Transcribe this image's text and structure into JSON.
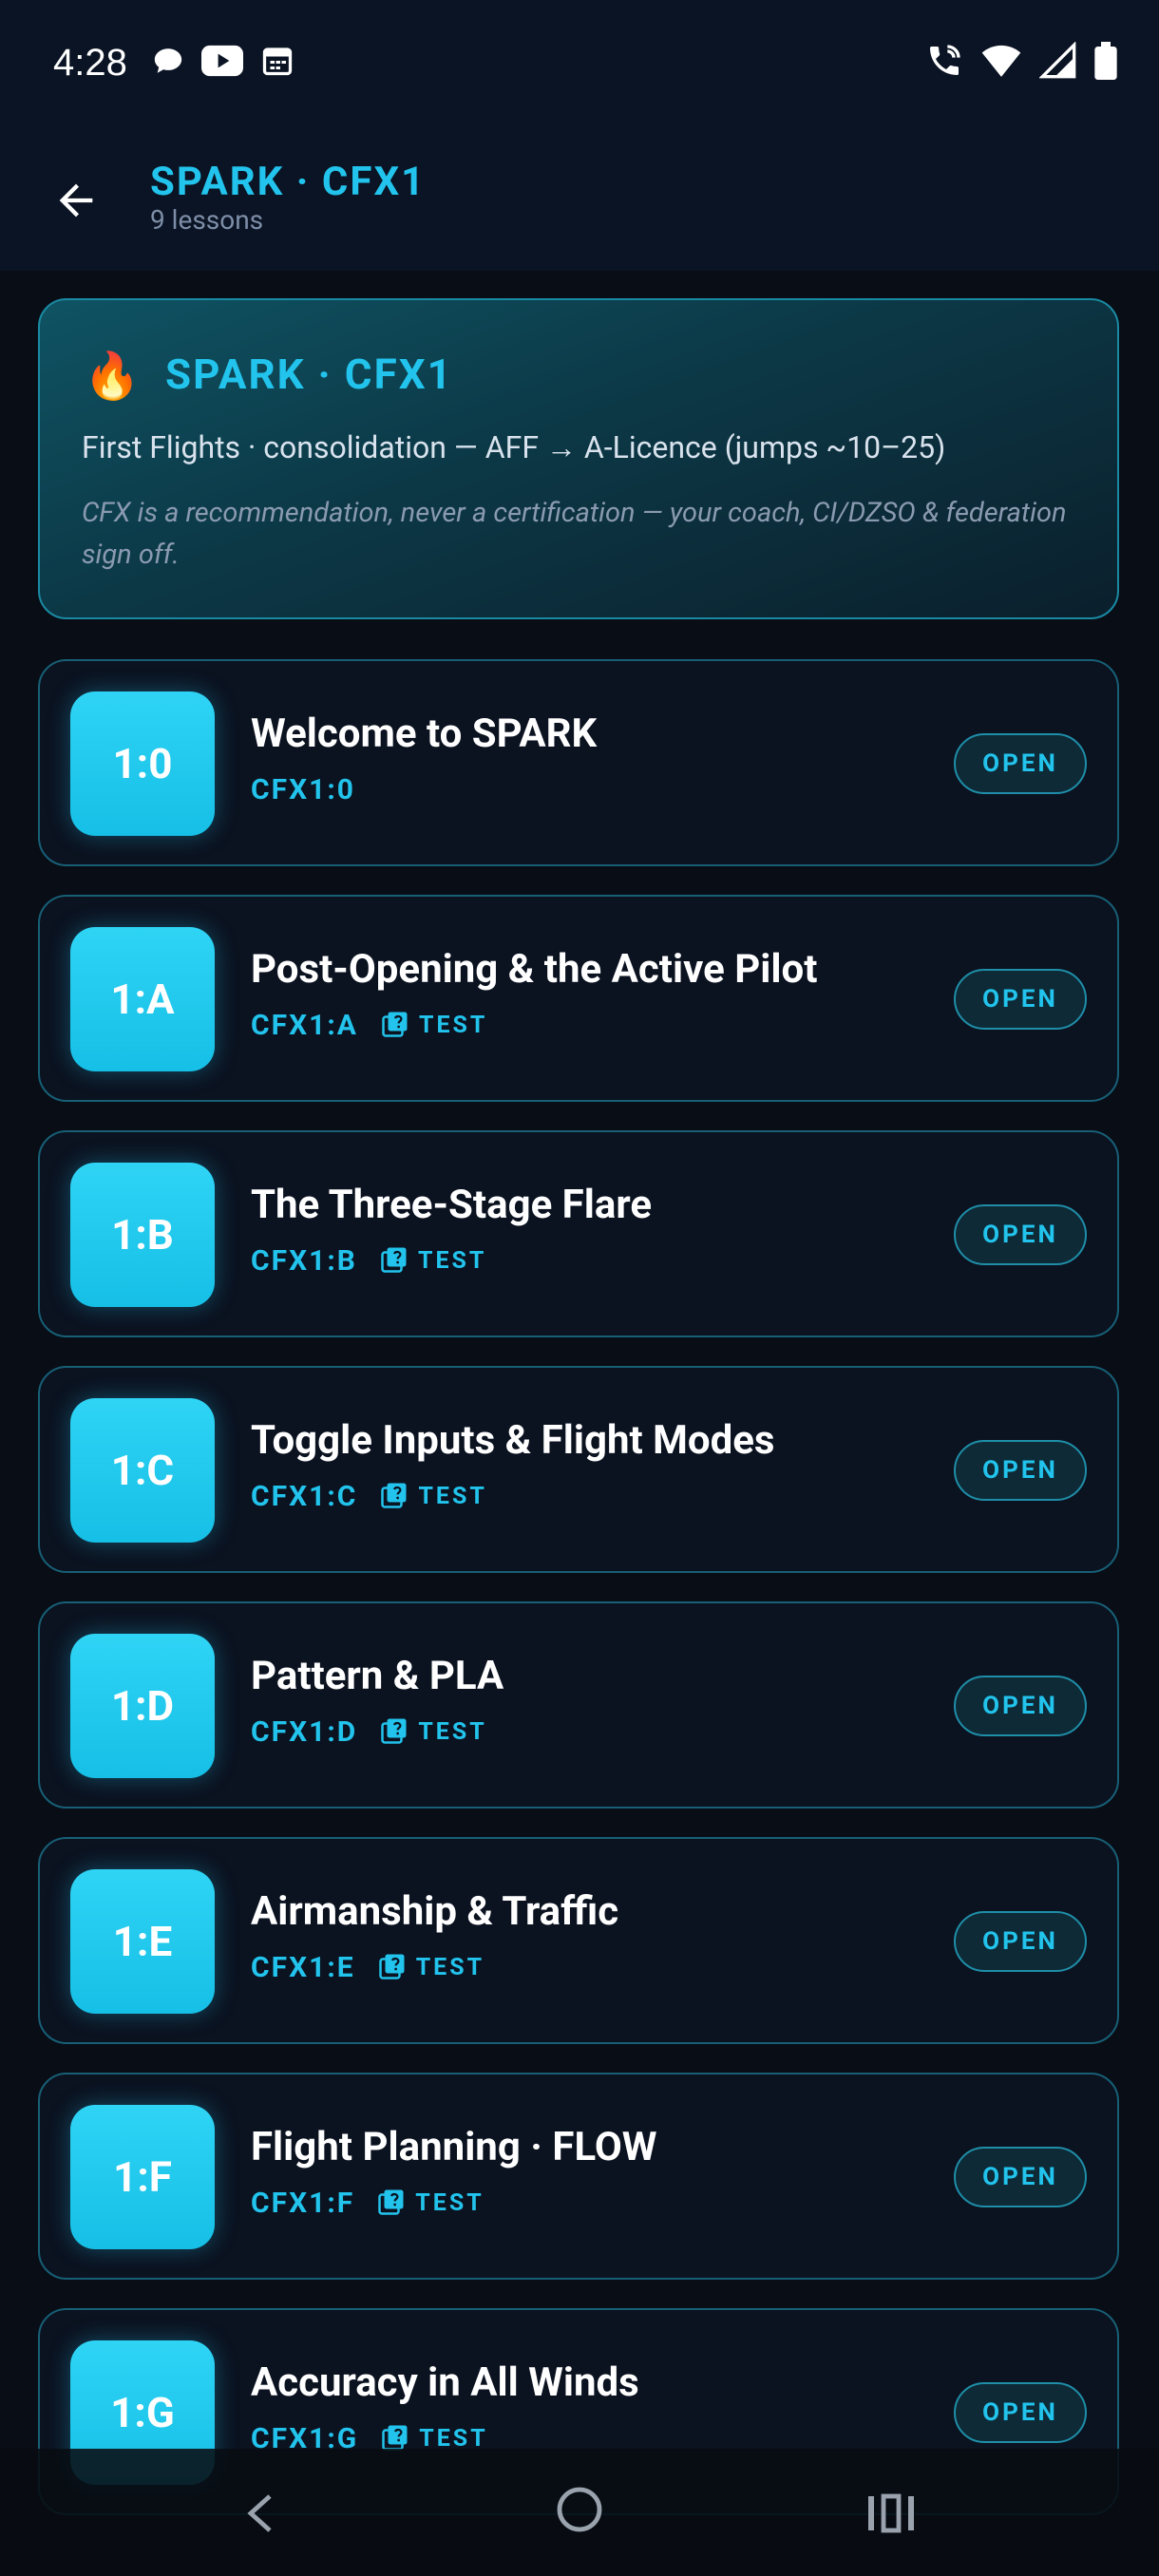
{
  "status_bar": {
    "time": "4:28",
    "left_icons": [
      "chat-bubble-icon",
      "youtube-icon",
      "calendar-icon"
    ],
    "right_icons": [
      "wifi-calling-icon",
      "wifi-icon",
      "signal-icon",
      "battery-icon"
    ]
  },
  "app_bar": {
    "title": "SPARK · CFX1",
    "subtitle": "9 lessons"
  },
  "hero": {
    "icon": "🔥",
    "title": "SPARK · CFX1",
    "description": "First Flights · consolidation — AFF → A-Licence (jumps ~10–25)",
    "note": "CFX is a recommendation, never a certification — your coach, CI/DZSO & federation sign off."
  },
  "open_label": "OPEN",
  "test_label": "TEST",
  "lessons": [
    {
      "badge": "1:0",
      "title": "Welcome to SPARK",
      "code": "CFX1:0",
      "has_test": false
    },
    {
      "badge": "1:A",
      "title": "Post-Opening & the Active Pilot",
      "code": "CFX1:A",
      "has_test": true
    },
    {
      "badge": "1:B",
      "title": "The Three-Stage Flare",
      "code": "CFX1:B",
      "has_test": true
    },
    {
      "badge": "1:C",
      "title": "Toggle Inputs & Flight Modes",
      "code": "CFX1:C",
      "has_test": true
    },
    {
      "badge": "1:D",
      "title": "Pattern & PLA",
      "code": "CFX1:D",
      "has_test": true
    },
    {
      "badge": "1:E",
      "title": "Airmanship & Traffic",
      "code": "CFX1:E",
      "has_test": true
    },
    {
      "badge": "1:F",
      "title": "Flight Planning · FLOW",
      "code": "CFX1:F",
      "has_test": true
    },
    {
      "badge": "1:G",
      "title": "Accuracy in All Winds",
      "code": "CFX1:G",
      "has_test": true
    }
  ],
  "colors": {
    "accent": "#22c3ec",
    "background": "#080d16",
    "card_border": "#175f75"
  }
}
